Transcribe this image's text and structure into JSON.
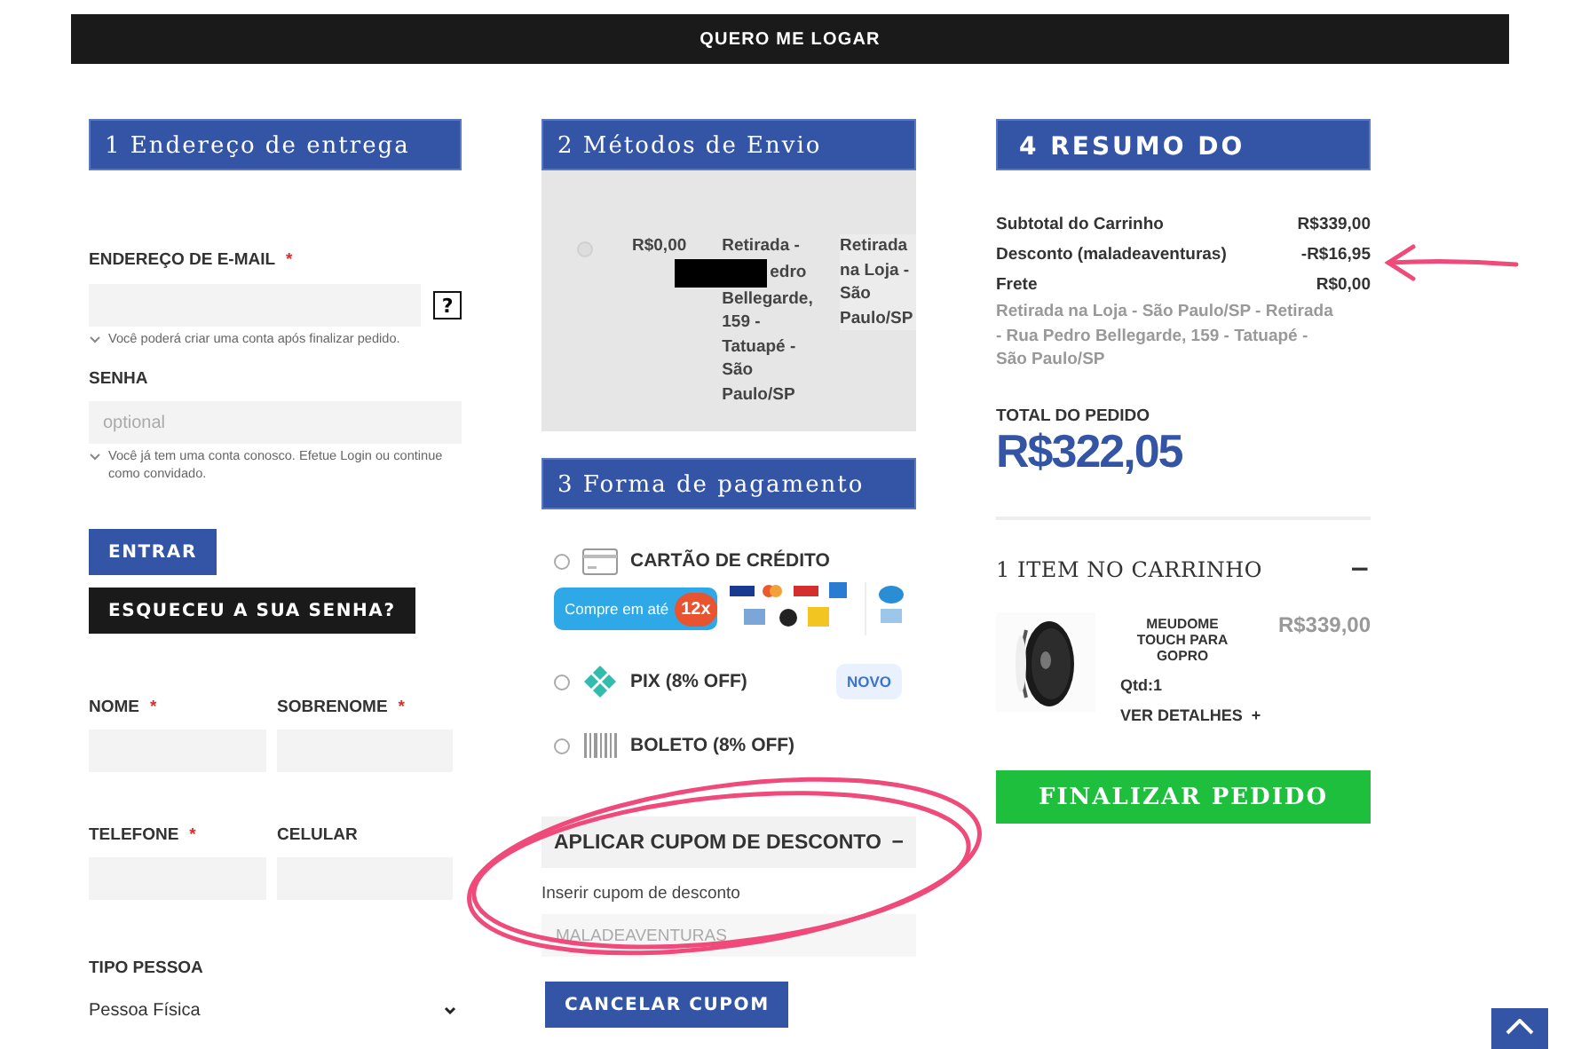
{
  "login_bar": {
    "label": "QUERO ME LOGAR"
  },
  "address": {
    "title": "1 Endereço de entrega",
    "email": {
      "label": "ENDEREÇO DE E-MAIL",
      "required_mark": "*",
      "help_button": "?",
      "hint": "Você poderá criar uma conta após finalizar pedido."
    },
    "password": {
      "label": "SENHA",
      "placeholder": "optional",
      "hint": "Você já tem uma conta conosco. Efetue Login ou continue como convidado."
    },
    "login_button": "ENTRAR",
    "forgot_button": "ESQUECEU A SUA SENHA?",
    "fields": [
      {
        "label": "NOME",
        "required_mark": "*"
      },
      {
        "label": "SOBRENOME",
        "required_mark": "*"
      },
      {
        "label": "TELEFONE",
        "required_mark": "*"
      },
      {
        "label": "CELULAR"
      }
    ],
    "person_type": {
      "label": "TIPO PESSOA",
      "value": "Pessoa Física"
    }
  },
  "shipping": {
    "title": "2 Métodos de Envio",
    "methods": [
      {
        "selected": false,
        "price": "R$0,00",
        "carrier_start": "Retirada -",
        "carrier_middle": "edro",
        "carrier_end": "Bellegarde, 159 - Tatuapé - São Paulo/SP",
        "method": "Retirada na Loja - São Paulo/SP"
      }
    ]
  },
  "payment": {
    "title": "3 Forma de pagamento",
    "options": [
      {
        "kind": "card",
        "label": "CARTÃO DE CRÉDITO",
        "selected": false,
        "installment_text": "Compre em até",
        "installment_count": "12x"
      },
      {
        "kind": "pix",
        "label": "PIX (8% OFF)",
        "selected": false,
        "badge": "NOVO"
      },
      {
        "kind": "boleto",
        "label": "BOLETO (8% OFF)",
        "selected": false
      }
    ],
    "coupon": {
      "title": "APLICAR CUPOM DE DESCONTO",
      "toggle": "−",
      "expanded": true,
      "label": "Inserir cupom de desconto",
      "placeholder": "MALADEAVENTURAS",
      "button": "CANCELAR CUPOM"
    }
  },
  "summary": {
    "title": "4 RESUMO DO",
    "lines": [
      {
        "label": "Subtotal do Carrinho",
        "value": "R$339,00"
      },
      {
        "label": "Desconto (maladeaventuras)",
        "value": "-R$16,95"
      },
      {
        "label": "Frete",
        "value": "R$0,00"
      }
    ],
    "shipping_note": "Retirada na Loja - São Paulo/SP - Retirada - Rua Pedro Bellegarde, 159 - Tatuapé - São Paulo/SP",
    "total_label": "TOTAL DO PEDIDO",
    "total": "R$322,05",
    "cart": {
      "title": "1 ITEM NO CARRINHO",
      "toggle": "−",
      "expanded": true,
      "items": [
        {
          "name": "MEUDOME TOUCH PARA GOPRO",
          "qty": "Qtd:1",
          "details": "VER DETALHES",
          "details_icon": "+",
          "price": "R$339,00"
        }
      ]
    },
    "checkout_button": "FINALIZAR PEDIDO"
  },
  "annotations": [
    {
      "kind": "ellipse"
    },
    {
      "kind": "arrow"
    }
  ]
}
